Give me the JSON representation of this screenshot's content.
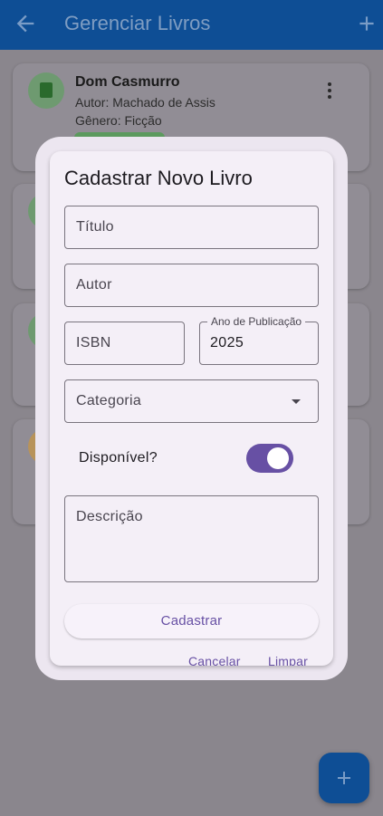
{
  "app_bar": {
    "title": "Gerenciar Livros",
    "back_icon": "arrow-back-icon",
    "add_icon": "plus-icon"
  },
  "book_list": [
    {
      "title": "Dom Casmurro",
      "author": "Autor: Machado de Assis",
      "genre": "Gênero: Ficção",
      "icon": "book-icon"
    }
  ],
  "dialog": {
    "title": "Cadastrar Novo Livro",
    "fields": {
      "titulo": {
        "label": "Título",
        "value": ""
      },
      "autor": {
        "label": "Autor",
        "value": ""
      },
      "isbn": {
        "label": "ISBN",
        "value": ""
      },
      "ano": {
        "label": "Ano de Publicação",
        "value": "2025"
      },
      "categoria": {
        "label": "Categoria",
        "value": ""
      },
      "descricao": {
        "label": "Descrição",
        "value": ""
      }
    },
    "available": {
      "label": "Disponível?",
      "checked": true
    },
    "buttons": {
      "submit": "Cadastrar",
      "cancel": "Cancelar",
      "clear": "Limpar"
    }
  },
  "fab": {
    "icon": "plus-icon"
  },
  "colors": {
    "primary": "#0e4e95",
    "accent": "#6750a4",
    "dialog_bg": "#f4eff7",
    "scrim_bg": "#8a868d"
  }
}
